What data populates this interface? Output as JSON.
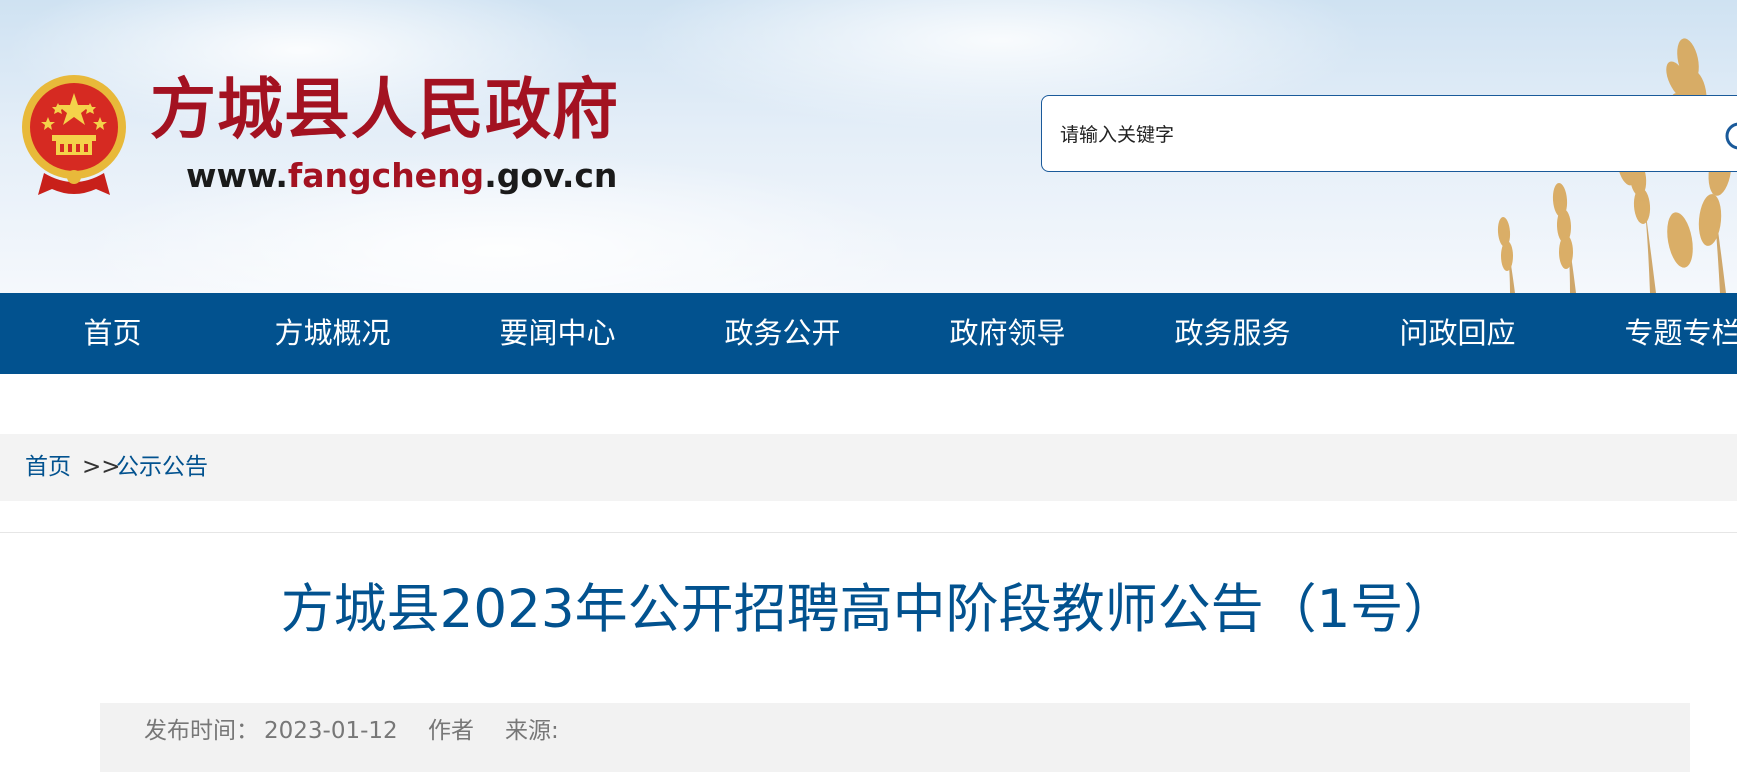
{
  "header": {
    "site_title": "方城县人民政府",
    "site_url_prefix": "www.",
    "site_url_highlight": "fangcheng",
    "site_url_suffix": ".gov.cn",
    "search_placeholder": "请输入关键字"
  },
  "nav": {
    "items": [
      {
        "label": "首页"
      },
      {
        "label": "方城概况"
      },
      {
        "label": "要闻中心"
      },
      {
        "label": "政务公开"
      },
      {
        "label": "政府领导"
      },
      {
        "label": "政务服务"
      },
      {
        "label": "问政回应"
      },
      {
        "label": "专题专栏"
      }
    ]
  },
  "breadcrumb": {
    "home": "首页",
    "separator": ">>",
    "current": "公示公告"
  },
  "article": {
    "title": "方城县2023年公开招聘高中阶段教师公告（1号）",
    "meta": {
      "date_label": "发布时间：",
      "date": "2023-01-12",
      "author_label": "作者",
      "source_label": "来源:"
    }
  },
  "colors": {
    "nav_background": "#02528f",
    "title_red": "#a31221",
    "link_blue": "#02528f",
    "breadcrumb_background": "#f3f3f3"
  },
  "icons": [
    "national-emblem-icon",
    "search-icon",
    "wheat-decoration"
  ]
}
